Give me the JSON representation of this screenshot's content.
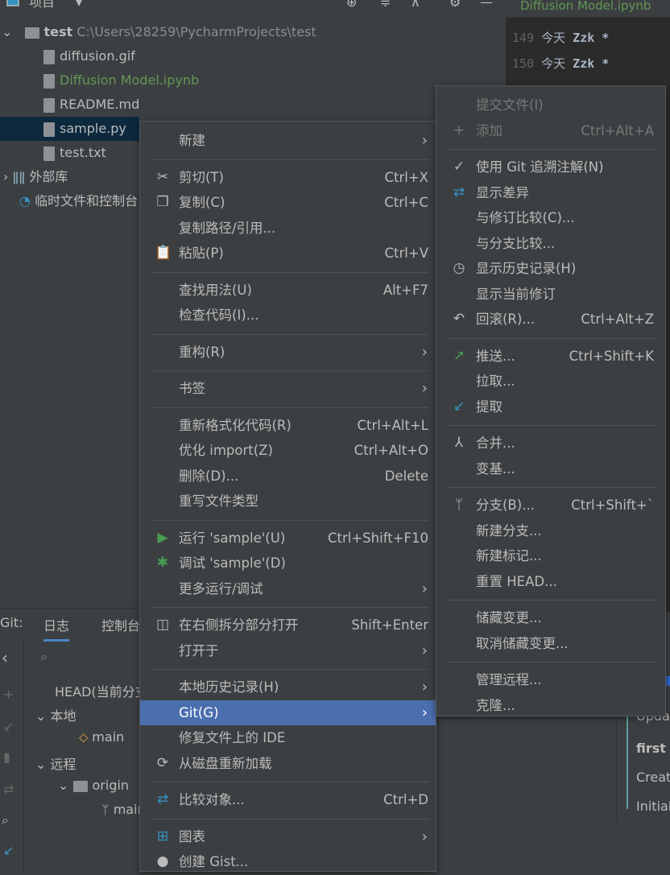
{
  "toolbar": {
    "project_label": "项目",
    "editor_tab": "Diffusion Model.ipynb"
  },
  "editor": {
    "lines": [
      {
        "num": "149",
        "text": "今天",
        "author": "Zzk *"
      },
      {
        "num": "150",
        "text": "今天",
        "author": "Zzk *"
      }
    ]
  },
  "tree": {
    "root": {
      "name": "test",
      "path": "C:\\Users\\28259\\PycharmProjects\\test"
    },
    "files": [
      {
        "name": "diffusion.gif",
        "color": "#bbbbbb"
      },
      {
        "name": "Diffusion Model.ipynb",
        "color": "#629755"
      },
      {
        "name": "README.md",
        "color": "#bbbbbb"
      },
      {
        "name": "sample.py",
        "color": "#bbbbbb",
        "selected": true
      },
      {
        "name": "test.txt",
        "color": "#bbbbbb"
      }
    ],
    "external": "外部库",
    "scratches": "临时文件和控制台"
  },
  "git_panel": {
    "label": "Git:",
    "tabs": [
      "日志",
      "控制台"
    ],
    "head": "HEAD(当前分支)",
    "local": "本地",
    "local_branch": "main",
    "remote": "远程",
    "origin": "origin",
    "remote_branch": "main",
    "commits": [
      "Update",
      "first",
      "Create",
      "Initial"
    ]
  },
  "main_menu": [
    {
      "label": "新建",
      "arrow": true
    },
    {
      "sep": true
    },
    {
      "icon": "scissors",
      "glyph": "✂",
      "label": "剪切(T)",
      "shortcut": "Ctrl+X"
    },
    {
      "icon": "copy",
      "glyph": "❐",
      "label": "复制(C)",
      "shortcut": "Ctrl+C"
    },
    {
      "label": "复制路径/引用..."
    },
    {
      "icon": "clipboard",
      "glyph": "📋",
      "label": "粘贴(P)",
      "shortcut": "Ctrl+V"
    },
    {
      "sep": true
    },
    {
      "label": "查找用法(U)",
      "shortcut": "Alt+F7"
    },
    {
      "label": "检查代码(I)..."
    },
    {
      "sep": true
    },
    {
      "label": "重构(R)",
      "arrow": true
    },
    {
      "sep": true
    },
    {
      "label": "书签",
      "arrow": true
    },
    {
      "sep": true
    },
    {
      "label": "重新格式化代码(R)",
      "shortcut": "Ctrl+Alt+L"
    },
    {
      "label": "优化 import(Z)",
      "shortcut": "Ctrl+Alt+O"
    },
    {
      "label": "删除(D)...",
      "shortcut": "Delete"
    },
    {
      "label": "重写文件类型"
    },
    {
      "sep": true
    },
    {
      "icon": "run",
      "glyph": "▶",
      "color": "#499c54",
      "label": "运行 'sample'(U)",
      "shortcut": "Ctrl+Shift+F10"
    },
    {
      "icon": "debug",
      "glyph": "✱",
      "color": "#499c54",
      "label": "调试 'sample'(D)"
    },
    {
      "label": "更多运行/调试",
      "arrow": true
    },
    {
      "sep": true
    },
    {
      "icon": "split",
      "glyph": "◫",
      "label": "在右侧拆分部分打开",
      "shortcut": "Shift+Enter"
    },
    {
      "label": "打开于",
      "arrow": true
    },
    {
      "sep": true
    },
    {
      "label": "本地历史记录(H)",
      "arrow": true
    },
    {
      "label": "Git(G)",
      "arrow": true,
      "selected": true
    },
    {
      "label": "修复文件上的 IDE"
    },
    {
      "icon": "reload",
      "glyph": "⟳",
      "label": "从磁盘重新加载"
    },
    {
      "sep": true
    },
    {
      "icon": "compare",
      "glyph": "⇄",
      "color": "#3592c4",
      "label": "比较对象...",
      "shortcut": "Ctrl+D"
    },
    {
      "sep": true
    },
    {
      "icon": "diagram",
      "glyph": "⊞",
      "color": "#3592c4",
      "label": "图表",
      "arrow": true
    },
    {
      "icon": "github",
      "glyph": "●",
      "label": "创建 Gist..."
    }
  ],
  "git_menu": [
    {
      "label": "提交文件(I)",
      "disabled": true
    },
    {
      "icon": "plus",
      "glyph": "+",
      "label": "添加",
      "shortcut": "Ctrl+Alt+A",
      "disabled": true
    },
    {
      "sep": true
    },
    {
      "icon": "check",
      "glyph": "✓",
      "label": "使用 Git 追溯注解(N)"
    },
    {
      "icon": "diff",
      "glyph": "⇄",
      "color": "#3592c4",
      "label": "显示差异"
    },
    {
      "label": "与修订比较(C)..."
    },
    {
      "label": "与分支比较..."
    },
    {
      "icon": "clock",
      "glyph": "◷",
      "label": "显示历史记录(H)"
    },
    {
      "label": "显示当前修订"
    },
    {
      "icon": "rollback",
      "glyph": "↶",
      "label": "回滚(R)...",
      "shortcut": "Ctrl+Alt+Z"
    },
    {
      "sep": true
    },
    {
      "icon": "push",
      "glyph": "↗",
      "color": "#499c54",
      "label": "推送...",
      "shortcut": "Ctrl+Shift+K"
    },
    {
      "label": "拉取..."
    },
    {
      "icon": "fetch",
      "glyph": "↙",
      "color": "#3592c4",
      "label": "提取"
    },
    {
      "sep": true
    },
    {
      "icon": "merge",
      "glyph": "⅄",
      "label": "合并..."
    },
    {
      "label": "变基..."
    },
    {
      "sep": true
    },
    {
      "icon": "branch",
      "glyph": "ᛘ",
      "label": "分支(B)...",
      "shortcut": "Ctrl+Shift+`"
    },
    {
      "label": "新建分支..."
    },
    {
      "label": "新建标记..."
    },
    {
      "label": "重置 HEAD..."
    },
    {
      "sep": true
    },
    {
      "label": "储藏变更..."
    },
    {
      "label": "取消储藏变更..."
    },
    {
      "sep": true
    },
    {
      "label": "管理远程..."
    },
    {
      "label": "克隆..."
    }
  ]
}
